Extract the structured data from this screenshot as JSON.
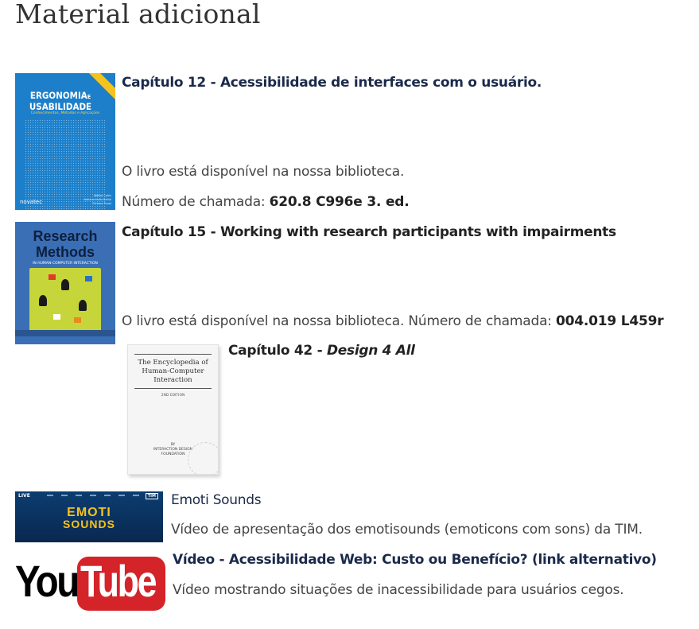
{
  "page_title": "Material adicional",
  "item1": {
    "heading": "Capítulo 12 - Acessibilidade de interfaces com o usuário.",
    "availability": "O livro está disponível na nossa biblioteca.",
    "call_label": "Número de chamada: ",
    "call_number": "620.8 C996e 3. ed.",
    "cover": {
      "title_line1": "ERGONOMIA",
      "title_e": "E",
      "title_line2": "USABILIDADE",
      "subtitle": "Conhecimentos, Métodos e Aplicações",
      "publisher": "novatec",
      "authors": [
        "Walter Cybis",
        "Adriana Holtz Betiol",
        "Richard Faust"
      ]
    }
  },
  "item2": {
    "heading": "Capítulo 15  - Working with research participants with impairments",
    "availability": "O livro está disponível na nossa biblioteca. Número de chamada: ",
    "call_number": "004.019 L459r",
    "cover": {
      "title_line1": "Research",
      "title_line2": "Methods",
      "subtitle": "IN HUMAN-COMPUTER INTERACTION"
    }
  },
  "item3": {
    "heading_prefix": "Capítulo 42 - ",
    "heading_link": "Design 4 All",
    "cover": {
      "title": "The Encyclopedia of Human-Computer Interaction",
      "edition": "2ND EDITION",
      "footer_line1": "BY",
      "footer_line2": "INTERACTION DESIGN",
      "footer_line3": "FOUNDATION"
    }
  },
  "item4": {
    "heading": "Emoti Sounds",
    "description": "Vídeo de apresentação dos emotisounds (emoticons com sons) da TIM.",
    "banner": {
      "brand": "LIVE",
      "tim": "TIM",
      "line1": "EMOTI",
      "line2": "SOUNDS"
    }
  },
  "item5": {
    "heading": "Vídeo - Acessibilidade Web: Custo ou Benefício? (link alternativo)",
    "description": "Vídeo mostrando situações de inacessibilidade para usuários cegos.",
    "logo": {
      "you": "You",
      "tube": "Tube"
    }
  },
  "colors": {
    "ergonomia_cover": "#1d7fc9",
    "research_cover": "#3a6fb6",
    "youtube_red": "#d4242a",
    "emoti_yellow": "#f6c21d"
  }
}
